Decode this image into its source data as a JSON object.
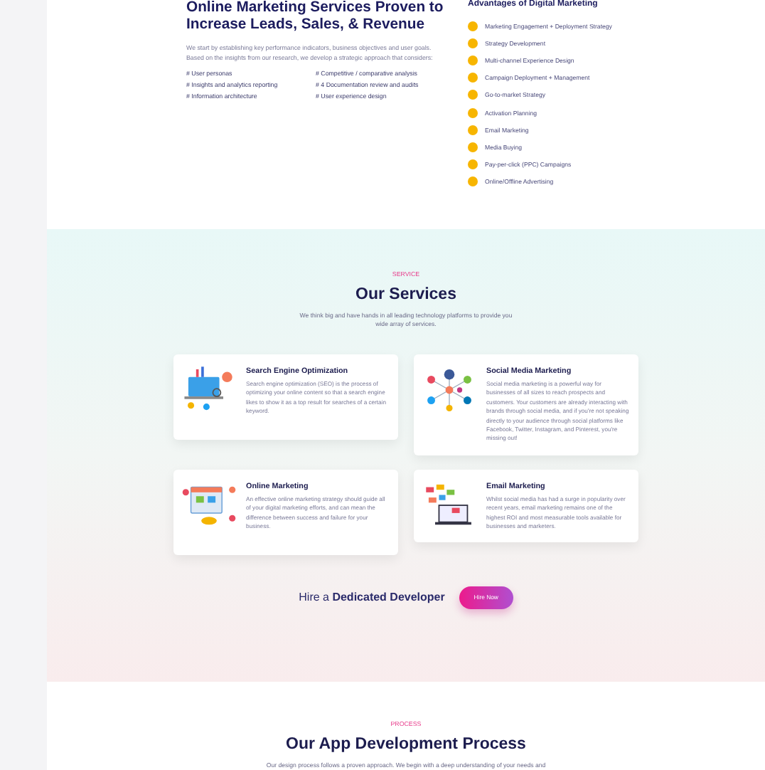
{
  "intro": {
    "title": "Online Marketing Services Proven to Increase Leads, Sales, & Revenue",
    "text": "We start by establishing key performance indicators, business objectives and user goals. Based on the insights from our research, we develop a strategic approach that considers:",
    "points": [
      "# User personas",
      "# Competitive / comparative analysis",
      "# Insights and analytics reporting",
      "# 4 Documentation review and audits",
      "# Information architecture",
      "# User experience design"
    ]
  },
  "advantages": {
    "title": "Advantages of Digital Marketing",
    "items": [
      "Marketing Engagement + Deployment Strategy",
      "Strategy Development",
      "Multi-channel Experience Design",
      "Campaign Deployment + Management",
      "Go-to-market Strategy",
      "Activation Planning",
      "Email Marketing",
      "Media Buying",
      "Pay-per-click (PPC) Campaigns",
      "Online/Offline Advertising"
    ]
  },
  "services": {
    "eyebrow": "SERVICE",
    "title": "Our Services",
    "text": "We think big and have hands in all leading technology platforms to provide you wide array of services.",
    "cards": [
      {
        "kind": "seo",
        "title": "Search Engine Optimization",
        "text": "Search engine optimization (SEO) is the process of optimizing your online content so that a search engine likes to show it as a top result for searches of a certain keyword."
      },
      {
        "kind": "social",
        "title": "Social Media Marketing",
        "text": "Social media marketing is a powerful way for businesses of all sizes to reach prospects and customers. Your customers are already interacting with brands through social media, and if you're not speaking directly to your audience through social platforms like Facebook, Twitter, Instagram, and Pinterest, you're missing out!"
      },
      {
        "kind": "online",
        "title": "Online Marketing",
        "text": "An effective online marketing strategy should guide all of your digital marketing efforts, and can mean the difference between success and failure for your business."
      },
      {
        "kind": "email",
        "title": "Email Marketing",
        "text": "Whilst social media has had a surge in popularity over recent years, email marketing remains one of the highest ROI and most measurable tools available for businesses and marketers."
      }
    ]
  },
  "hire": {
    "text": "Hire a **Dedicated Developer**",
    "button": "Hire Now"
  },
  "process": {
    "eyebrow": "PROCESS",
    "title": "Our App Development Process",
    "text": "Our design process follows a proven approach. We begin with a deep understanding of your needs and"
  }
}
